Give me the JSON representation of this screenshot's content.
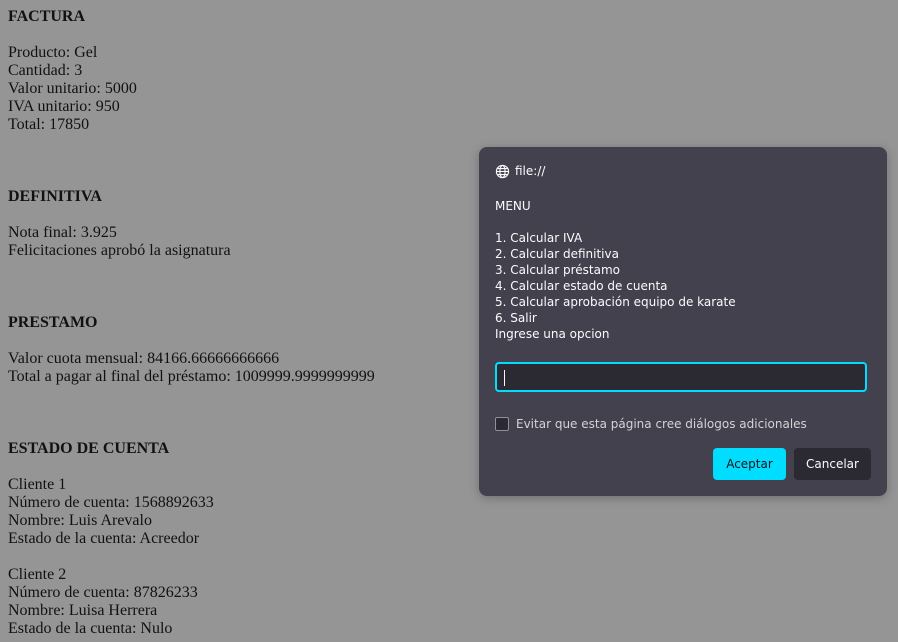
{
  "factura": {
    "heading": "FACTURA",
    "lines": [
      "Producto: Gel",
      "Cantidad: 3",
      "Valor unitario: 5000",
      "IVA unitario: 950",
      "Total: 17850"
    ]
  },
  "definitiva": {
    "heading": "DEFINITIVA",
    "lines": [
      "Nota final: 3.925",
      "Felicitaciones aprobó la asignatura"
    ]
  },
  "prestamo": {
    "heading": "PRESTAMO",
    "lines": [
      "Valor cuota mensual: 84166.66666666666",
      "Total a pagar al final del préstamo: 1009999.9999999999"
    ]
  },
  "estado": {
    "heading": "ESTADO DE CUENTA",
    "clients": [
      {
        "title": "Cliente 1",
        "account": "Número de cuenta: 1568892633",
        "name": "Nombre: Luis Arevalo",
        "status": "Estado de la cuenta: Acreedor"
      },
      {
        "title": "Cliente 2",
        "account": "Número de cuenta: 87826233",
        "name": "Nombre: Luisa Herrera",
        "status": "Estado de la cuenta: Nulo"
      }
    ]
  },
  "dialog": {
    "origin": "file://",
    "origin_icon": "globe-icon",
    "title": "MENU",
    "options": [
      "1. Calcular IVA",
      "2. Calcular definitiva",
      "3. Calcular préstamo",
      "4. Calcular estado de cuenta",
      "5. Calcular aprobación equipo de karate",
      "6. Salir"
    ],
    "prompt": "Ingrese una opcion",
    "input_value": "",
    "checkbox_label": "Evitar que esta página cree diálogos adicionales",
    "checkbox_checked": false,
    "ok_label": "Aceptar",
    "cancel_label": "Cancelar",
    "accent_color": "#00ddff",
    "background_color": "#42414d"
  }
}
